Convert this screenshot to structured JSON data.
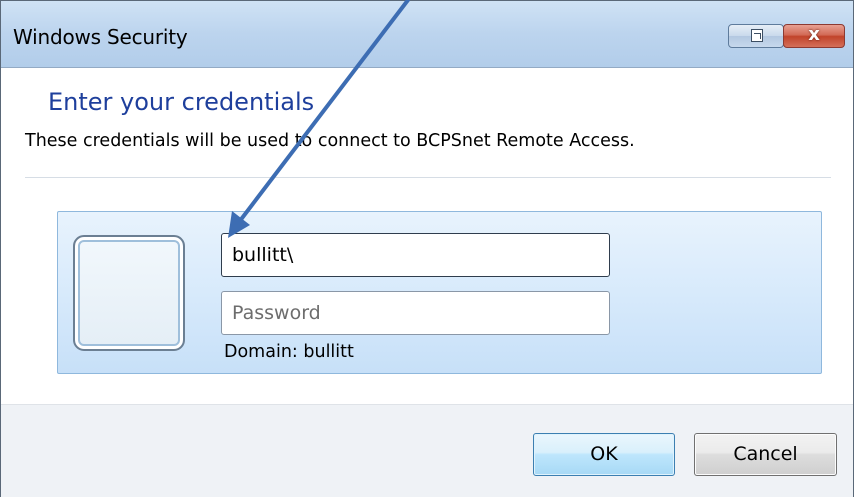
{
  "window": {
    "title": "Windows Security",
    "restore_icon": "restore-icon",
    "close_icon": "close-icon",
    "close_glyph": "x"
  },
  "dialog": {
    "heading": "Enter your credentials",
    "description": "These credentials will be used to connect to BCPSnet Remote Access."
  },
  "credentials": {
    "user_icon": "user-tile-icon",
    "username_value": "bullitt\\",
    "password_value": "",
    "password_placeholder": "Password",
    "domain_text": "Domain: bullitt"
  },
  "buttons": {
    "ok_label": "OK",
    "cancel_label": "Cancel"
  },
  "annotation": {
    "arrow_icon": "annotation-arrow-icon",
    "arrow_color": "#3d6db3"
  },
  "colors": {
    "heading": "#1e3f9c",
    "titlebar": "#bcd4ee",
    "tile_background": "#d6e9fb",
    "footer": "#eff2f6",
    "close_button": "#c1432a"
  }
}
